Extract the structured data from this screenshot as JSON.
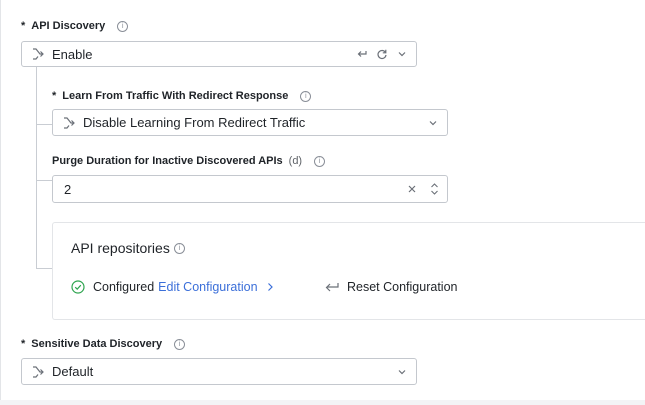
{
  "api_discovery": {
    "required_mark": "*",
    "label": "API Discovery",
    "value": "Enable"
  },
  "learn_redirect": {
    "required_mark": "*",
    "label": "Learn From Traffic With Redirect Response",
    "value": "Disable Learning From Redirect Traffic"
  },
  "purge_duration": {
    "label": "Purge Duration for Inactive Discovered APIs",
    "unit": "(d)",
    "value": "2"
  },
  "api_repositories": {
    "title": "API repositories",
    "status_text": "Configured",
    "edit_link": "Edit Configuration",
    "reset_label": "Reset Configuration"
  },
  "sensitive_data": {
    "required_mark": "*",
    "label": "Sensitive Data Discovery",
    "value": "Default"
  },
  "colors": {
    "link": "#3b6fd9",
    "success": "#2ea44f",
    "border": "#c4c8ce"
  },
  "icons": {
    "info": "info-icon",
    "merge": "merge-icon",
    "undo": "undo-icon",
    "refresh": "refresh-icon",
    "chevron": "chevron-down-icon",
    "clear": "clear-icon",
    "check": "check-circle-icon",
    "reset": "reset-icon"
  }
}
